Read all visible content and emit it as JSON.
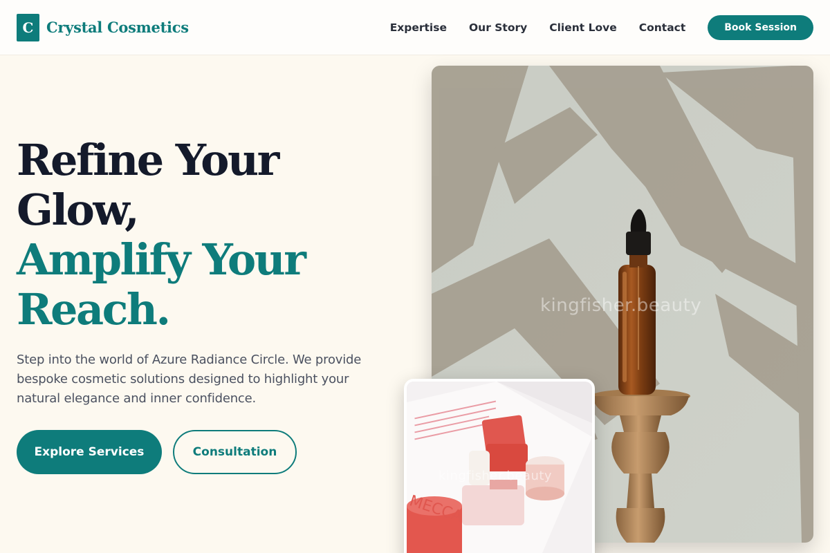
{
  "header": {
    "logo_letter": "C",
    "brand": "Crystal Cosmetics",
    "nav": [
      "Expertise",
      "Our Story",
      "Client Love",
      "Contact"
    ],
    "cta": "Book Session"
  },
  "hero": {
    "title_line1": "Refine Your",
    "title_line2": "Glow,",
    "title_line3": "Amplify Your",
    "title_line4": "Reach.",
    "description": "Step into the world of Azure Radiance Circle. We provide bespoke cosmetic solutions designed to highlight your natural elegance and inner confidence.",
    "primary_button": "Explore Services",
    "secondary_button": "Consultation"
  },
  "images": {
    "main_watermark": "kingfisher.beauty",
    "small_watermark": "kingfisher.beauty",
    "small_box_text": "MECCA"
  },
  "colors": {
    "accent": "#0e7c7b",
    "background": "#fdf9f0",
    "heading": "#141a2b"
  }
}
